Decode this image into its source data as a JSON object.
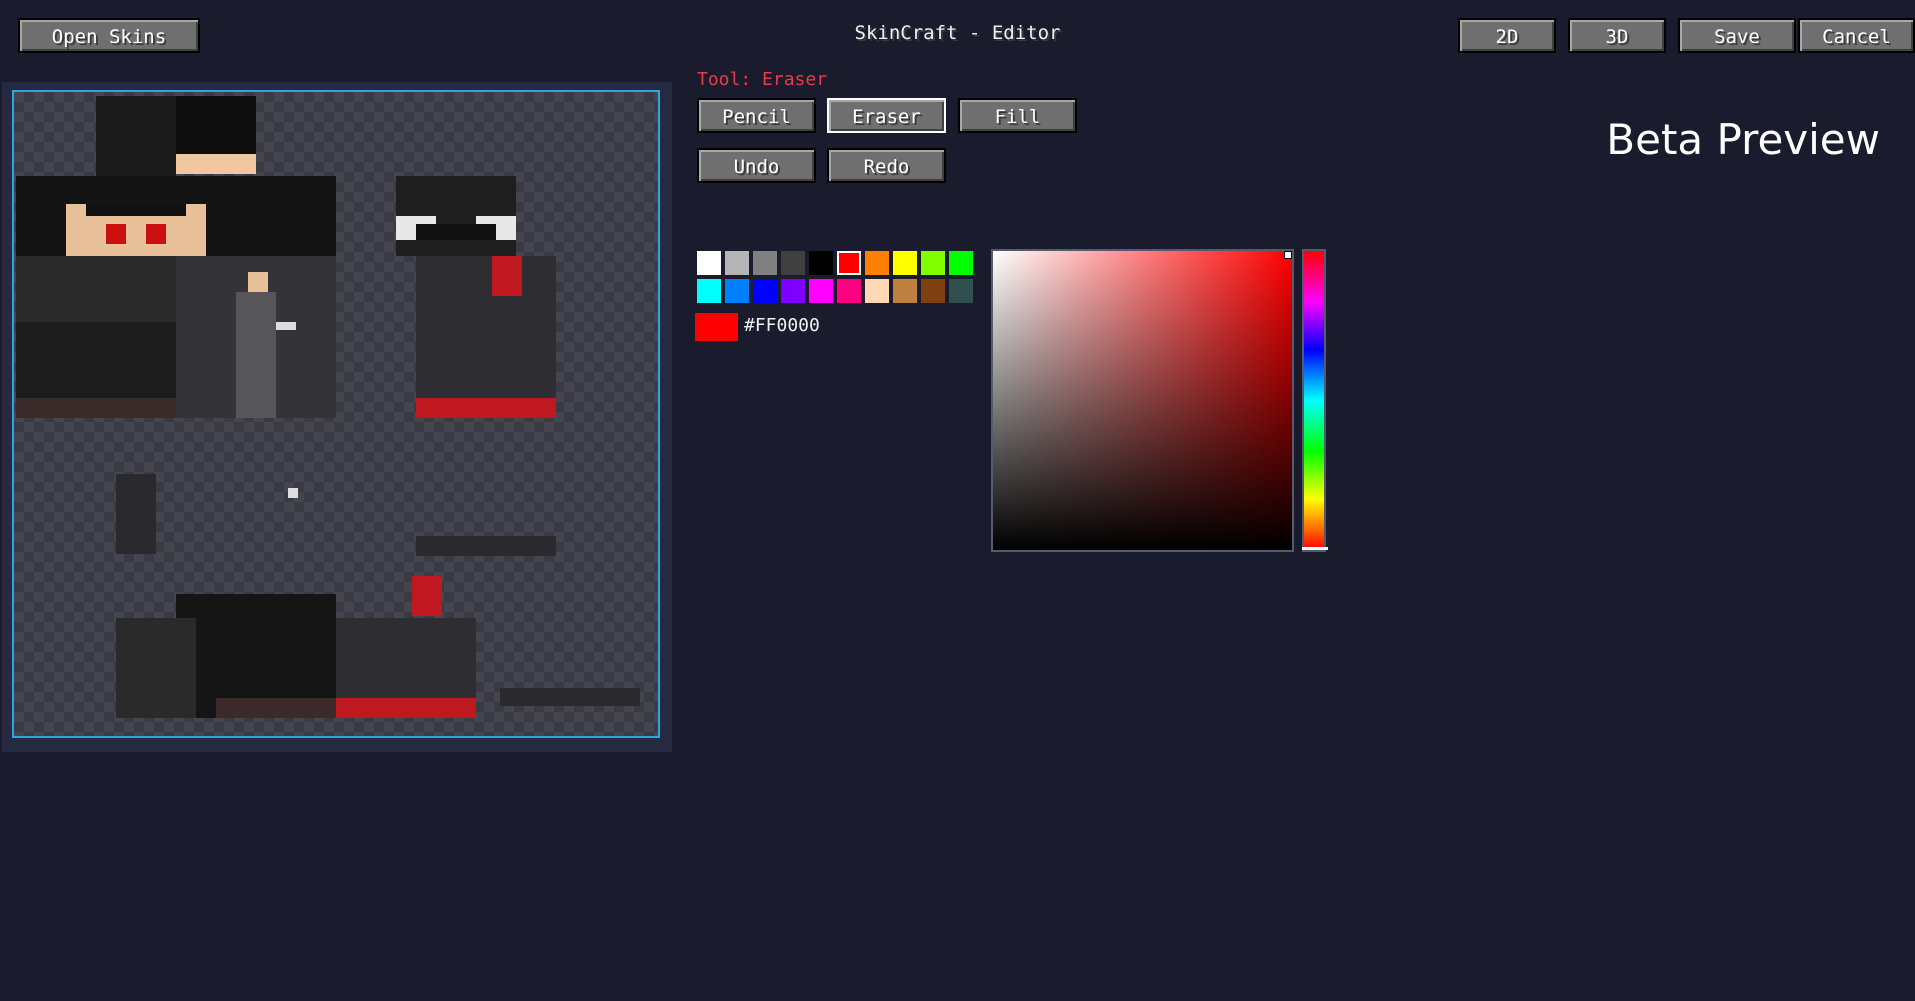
{
  "header": {
    "title": "SkinCraft - Editor",
    "open_skins_label": "Open Skins",
    "view_2d_label": "2D",
    "view_3d_label": "3D",
    "save_label": "Save",
    "cancel_label": "Cancel"
  },
  "beta_label": "Beta Preview",
  "tools": {
    "current_tool_text": "Tool: Eraser",
    "active_tool": "eraser",
    "pencil_label": "Pencil",
    "eraser_label": "Eraser",
    "fill_label": "Fill",
    "undo_label": "Undo",
    "redo_label": "Redo"
  },
  "palette": {
    "row1": [
      "#ffffff",
      "#b4b4b4",
      "#808080",
      "#404040",
      "#000000",
      "#ff0000",
      "#ff8000",
      "#ffff00",
      "#80ff00",
      "#00ff00"
    ],
    "row2": [
      "#00ffff",
      "#0080ff",
      "#0000ff",
      "#8000ff",
      "#ff00ff",
      "#ff0080",
      "#ffd8b4",
      "#c08040",
      "#804010",
      "#305050"
    ],
    "selected": "#ff0000"
  },
  "current_color": {
    "hex": "#FF0000",
    "value": "#ff0000"
  },
  "picker": {
    "hue": "#ff0000"
  },
  "canvas": {
    "accent": "#2aa8e0"
  }
}
